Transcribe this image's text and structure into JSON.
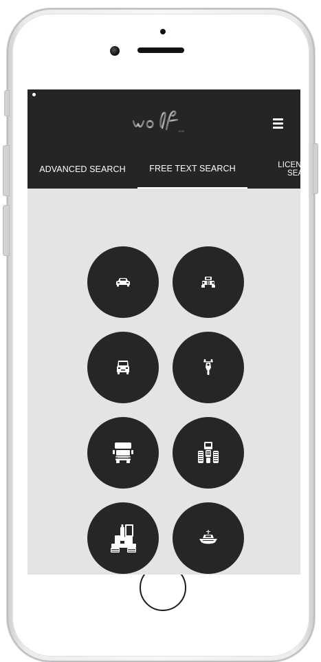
{
  "brand": {
    "logo_text": "wolf"
  },
  "tabs": [
    {
      "label": "ADVANCED SEARCH"
    },
    {
      "label": "FREE TEXT SEARCH",
      "active": true
    },
    {
      "label_line1": "LICENSE",
      "label_line2": "SEARCH"
    }
  ],
  "categories": [
    {
      "icon": "car-icon"
    },
    {
      "icon": "vintage-car-icon"
    },
    {
      "icon": "van-icon"
    },
    {
      "icon": "motorcycle-icon"
    },
    {
      "icon": "truck-icon"
    },
    {
      "icon": "tractor-icon"
    },
    {
      "icon": "construction-machine-icon"
    },
    {
      "icon": "boat-icon"
    }
  ],
  "colors": {
    "header_bg": "#252525",
    "screen_bg": "#e4e4e5",
    "circle_bg": "#262626",
    "icon": "#ffffff"
  }
}
